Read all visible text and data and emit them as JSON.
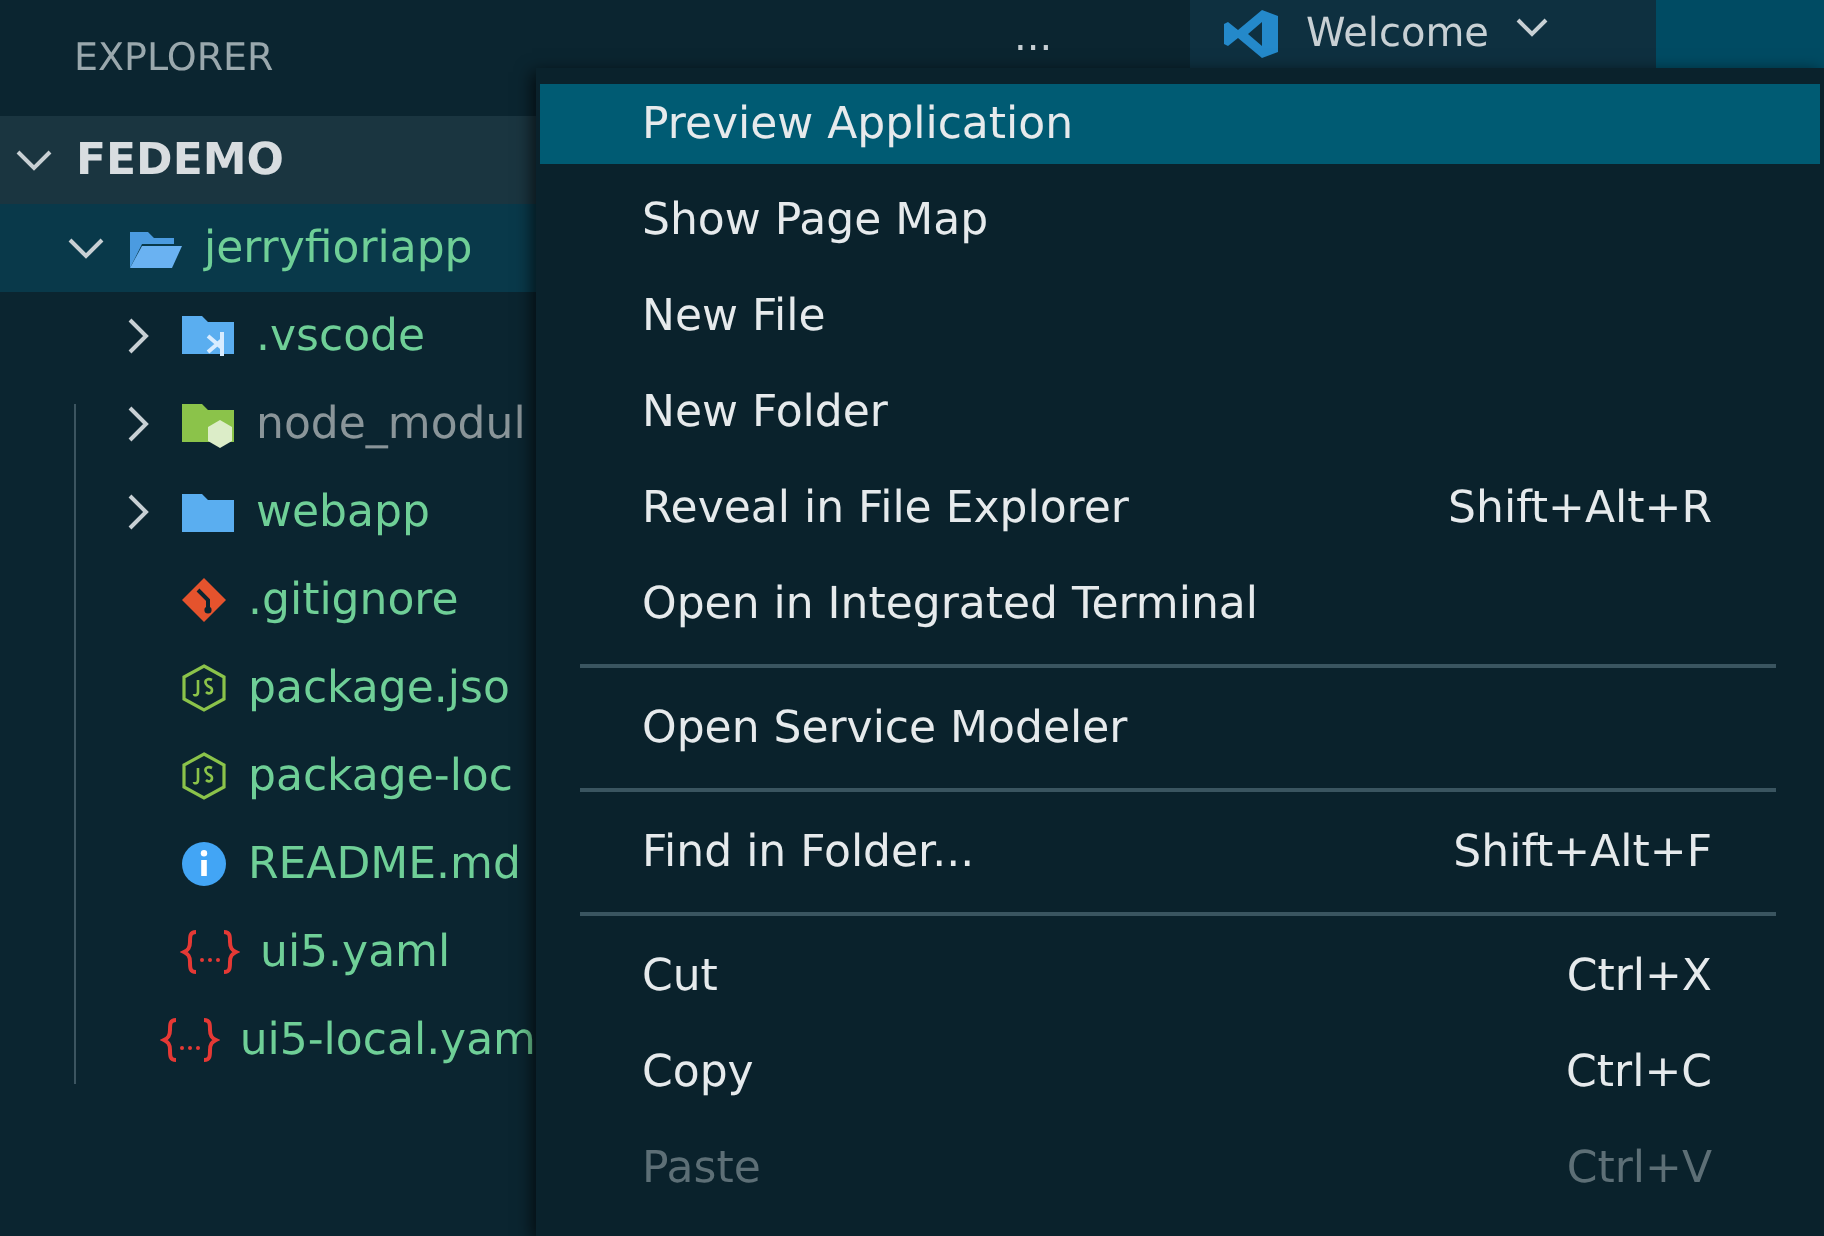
{
  "sidebar": {
    "title": "EXPLORER",
    "more": "...",
    "tree": [
      {
        "label": "FEDEMO",
        "kind": "root",
        "expanded": true,
        "selected": false,
        "children": [
          {
            "label": "jerryfioriapp",
            "kind": "folder",
            "expanded": true,
            "selected": true,
            "children": [
              {
                "label": ".vscode",
                "kind": "vscode-folder",
                "expanded": false,
                "ignored": false
              },
              {
                "label": "node_modul",
                "kind": "node-folder",
                "expanded": false,
                "ignored": true
              },
              {
                "label": "webapp",
                "kind": "folder",
                "expanded": false,
                "ignored": false
              },
              {
                "label": ".gitignore",
                "kind": "git",
                "ignored": false
              },
              {
                "label": "package.jso",
                "kind": "node",
                "ignored": false
              },
              {
                "label": "package-loc",
                "kind": "node",
                "ignored": false
              },
              {
                "label": "README.md",
                "kind": "info",
                "ignored": false
              },
              {
                "label": "ui5.yaml",
                "kind": "yaml",
                "ignored": false
              },
              {
                "label": "ui5-local.yam",
                "kind": "yaml",
                "ignored": false
              }
            ]
          }
        ]
      }
    ]
  },
  "tab": {
    "label": "Welcome"
  },
  "context_menu": {
    "groups": [
      [
        {
          "label": "Preview Application",
          "selected": true,
          "disabled": false
        },
        {
          "label": "Show Page Map",
          "selected": false,
          "disabled": false
        },
        {
          "label": "New File",
          "selected": false,
          "disabled": false
        },
        {
          "label": "New Folder",
          "selected": false,
          "disabled": false
        },
        {
          "label": "Reveal in File Explorer",
          "shortcut": "Shift+Alt+R",
          "selected": false,
          "disabled": false
        },
        {
          "label": "Open in Integrated Terminal",
          "selected": false,
          "disabled": false
        }
      ],
      [
        {
          "label": "Open Service Modeler",
          "selected": false,
          "disabled": false
        }
      ],
      [
        {
          "label": "Find in Folder...",
          "shortcut": "Shift+Alt+F",
          "selected": false,
          "disabled": false
        }
      ],
      [
        {
          "label": "Cut",
          "shortcut": "Ctrl+X",
          "selected": false,
          "disabled": false
        },
        {
          "label": "Copy",
          "shortcut": "Ctrl+C",
          "selected": false,
          "disabled": false
        },
        {
          "label": "Paste",
          "shortcut": "Ctrl+V",
          "selected": false,
          "disabled": true
        }
      ]
    ]
  }
}
